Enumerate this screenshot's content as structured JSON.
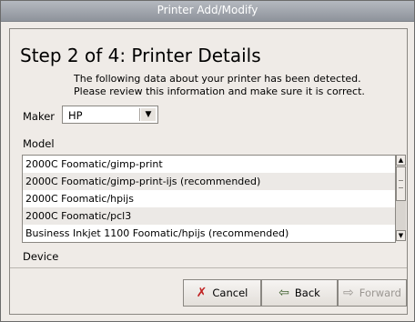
{
  "window": {
    "title": "Printer Add/Modify"
  },
  "page": {
    "heading": "Step 2 of 4: Printer Details",
    "description_line1": "The following data about your printer has been detected.",
    "description_line2": "Please review this information and make sure it is correct."
  },
  "maker": {
    "label": "Maker",
    "value": "HP"
  },
  "model": {
    "label": "Model",
    "items": [
      "2000C Foomatic/gimp-print",
      "2000C Foomatic/gimp-print-ijs (recommended)",
      "2000C Foomatic/hpijs",
      "2000C Foomatic/pcl3",
      "Business Inkjet 1100 Foomatic/hpijs (recommended)"
    ]
  },
  "device": {
    "label": "Device"
  },
  "buttons": {
    "cancel": {
      "label": "Cancel",
      "icon": "x-icon"
    },
    "back": {
      "label": "Back",
      "icon": "back-arrow-icon"
    },
    "forward": {
      "label": "Forward",
      "icon": "forward-arrow-icon"
    }
  }
}
